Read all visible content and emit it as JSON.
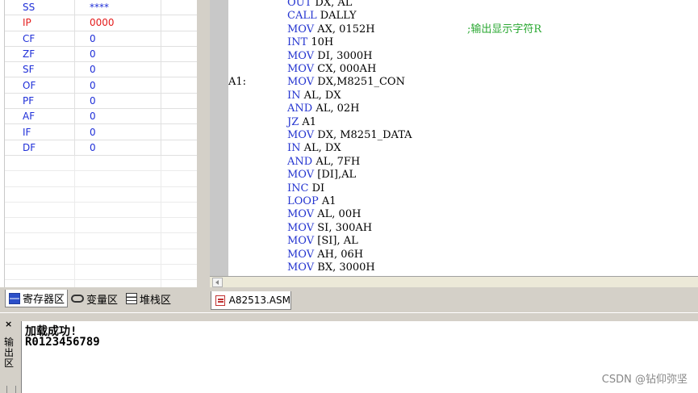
{
  "registers": [
    {
      "name": "SS",
      "value": "****",
      "red": false
    },
    {
      "name": "IP",
      "value": "0000",
      "red": true
    },
    {
      "name": "CF",
      "value": "0",
      "red": false
    },
    {
      "name": "ZF",
      "value": "0",
      "red": false
    },
    {
      "name": "SF",
      "value": "0",
      "red": false
    },
    {
      "name": "OF",
      "value": "0",
      "red": false
    },
    {
      "name": "PF",
      "value": "0",
      "red": false
    },
    {
      "name": "AF",
      "value": "0",
      "red": false
    },
    {
      "name": "IF",
      "value": "0",
      "red": false
    },
    {
      "name": "DF",
      "value": "0",
      "red": false
    }
  ],
  "left_tabs": {
    "registers": "寄存器区",
    "variables": "变量区",
    "stack": "堆栈区"
  },
  "code_lines": [
    {
      "label": "",
      "op": "OUT",
      "args": " DX, AL",
      "comment": ""
    },
    {
      "label": "",
      "op": "CALL",
      "args": " DALLY",
      "comment": ""
    },
    {
      "label": "",
      "op": "MOV",
      "args": " AX, 0152H",
      "comment": ";输出显示字符R"
    },
    {
      "label": "",
      "op": "INT",
      "args": " 10H",
      "comment": ""
    },
    {
      "label": "",
      "op": "MOV",
      "args": " DI, 3000H",
      "comment": ""
    },
    {
      "label": "",
      "op": "MOV",
      "args": " CX, 000AH",
      "comment": ""
    },
    {
      "label": "A1:",
      "op": "MOV",
      "args": " DX,M8251_CON",
      "comment": ""
    },
    {
      "label": "",
      "op": "IN",
      "args": " AL, DX",
      "comment": ""
    },
    {
      "label": "",
      "op": "AND",
      "args": " AL, 02H",
      "comment": ""
    },
    {
      "label": "",
      "op": "JZ",
      "args": " A1",
      "comment": ""
    },
    {
      "label": "",
      "op": "MOV",
      "args": " DX, M8251_DATA",
      "comment": ""
    },
    {
      "label": "",
      "op": "IN",
      "args": " AL, DX",
      "comment": ""
    },
    {
      "label": "",
      "op": "AND",
      "args": " AL, 7FH",
      "comment": ""
    },
    {
      "label": "",
      "op": "MOV",
      "args": " [DI],AL",
      "comment": ""
    },
    {
      "label": "",
      "op": "INC",
      "args": " DI",
      "comment": ""
    },
    {
      "label": "",
      "op": "LOOP",
      "args": " A1",
      "comment": ""
    },
    {
      "label": "",
      "op": "MOV",
      "args": " AL, 00H",
      "comment": ""
    },
    {
      "label": "",
      "op": "MOV",
      "args": " SI, 300AH",
      "comment": ""
    },
    {
      "label": "",
      "op": "MOV",
      "args": " [SI], AL",
      "comment": ""
    },
    {
      "label": "",
      "op": "MOV",
      "args": " AH, 06H",
      "comment": ""
    },
    {
      "label": "",
      "op": "MOV",
      "args": " BX, 3000H",
      "comment": ""
    }
  ],
  "file_tab": {
    "label": "A82513.ASM"
  },
  "output": {
    "close": "×",
    "title": "输出区",
    "lines": [
      "加载成功!",
      "R0123456789"
    ]
  },
  "watermark": "CSDN @钻仰弥坚",
  "colors": {
    "keyword": "#2535d0",
    "comment": "#2aa832",
    "ip_red": "#e41b1b",
    "register_blue": "#1f2fd8"
  },
  "icons": {
    "registers": "registers-icon",
    "variables": "glasses-icon",
    "stack": "stack-icon",
    "file": "asm-file-icon",
    "close": "close-icon"
  }
}
